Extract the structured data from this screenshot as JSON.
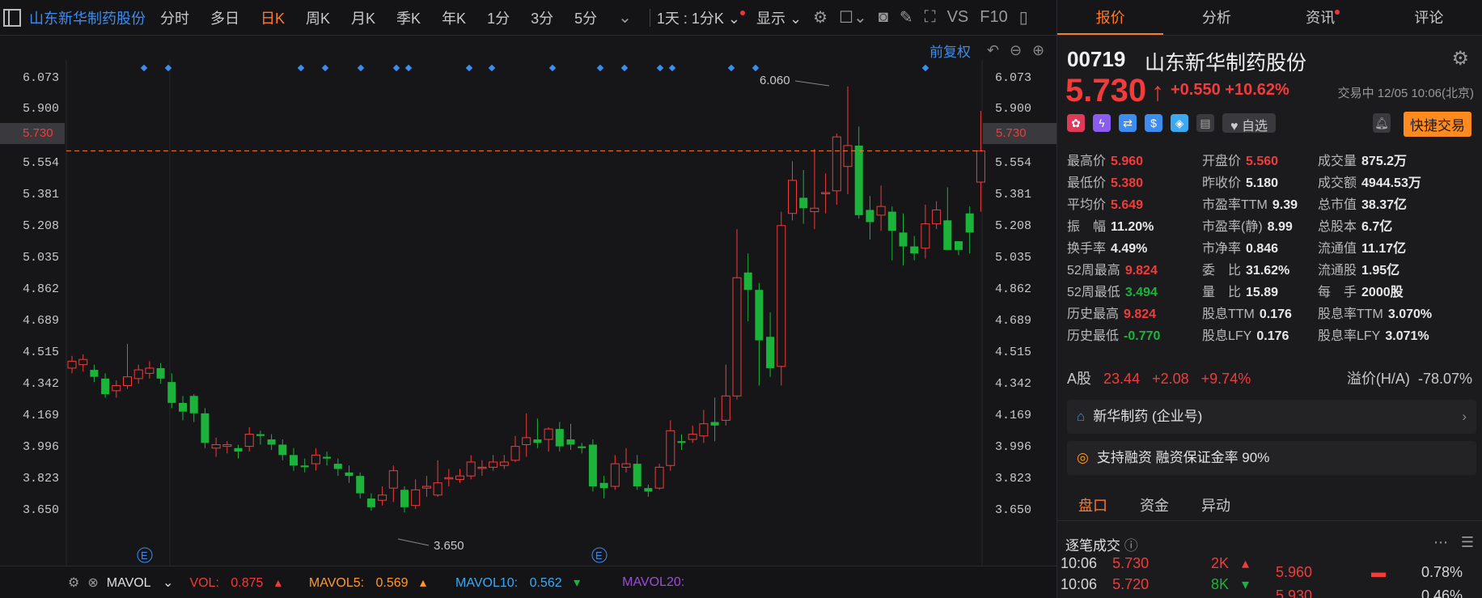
{
  "toolbar": {
    "stock_name": "山东新华制药股份",
    "tabs": [
      "分时",
      "多日",
      "日K",
      "周K",
      "月K",
      "季K",
      "年K",
      "1分",
      "3分",
      "5分"
    ],
    "active_tab": "日K",
    "period_select": "1天 : 1分K",
    "display_select": "显示",
    "vs_label": "VS",
    "f10_label": "F10"
  },
  "chart": {
    "restore_label": "前复权",
    "y_ticks": [
      "6.073",
      "5.900",
      "5.730",
      "5.554",
      "5.381",
      "5.208",
      "5.035",
      "4.862",
      "4.689",
      "4.515",
      "4.342",
      "4.169",
      "3.996",
      "3.823",
      "3.650"
    ],
    "current_price_label": "5.730",
    "high_mark": "6.060",
    "low_mark": "3.650",
    "event_marker": "E"
  },
  "chart_data": {
    "type": "candlestick",
    "ylim": [
      3.6,
      6.16
    ],
    "current_price": 5.73,
    "high_annotation": 6.06,
    "low_annotation": 3.65,
    "candles": [
      [
        4.48,
        4.52,
        4.55,
        4.45
      ],
      [
        4.5,
        4.53,
        4.56,
        4.46
      ],
      [
        4.47,
        4.43,
        4.5,
        4.4
      ],
      [
        4.42,
        4.33,
        4.45,
        4.31
      ],
      [
        4.35,
        4.38,
        4.41,
        4.31
      ],
      [
        4.38,
        4.43,
        4.62,
        4.36
      ],
      [
        4.42,
        4.47,
        4.5,
        4.39
      ],
      [
        4.45,
        4.48,
        4.52,
        4.42
      ],
      [
        4.48,
        4.42,
        4.51,
        4.39
      ],
      [
        4.4,
        4.28,
        4.45,
        4.25
      ],
      [
        4.28,
        4.23,
        4.32,
        4.18
      ],
      [
        4.32,
        4.22,
        4.33,
        4.17
      ],
      [
        4.22,
        4.05,
        4.25,
        4.02
      ],
      [
        4.02,
        4.04,
        4.08,
        3.97
      ],
      [
        4.03,
        4.04,
        4.06,
        3.99
      ],
      [
        4.02,
        4.0,
        4.04,
        3.96
      ],
      [
        4.03,
        4.1,
        4.14,
        4.0
      ],
      [
        4.1,
        4.09,
        4.12,
        4.04
      ],
      [
        4.07,
        4.04,
        4.1,
        4.01
      ],
      [
        4.04,
        3.98,
        4.07,
        3.95
      ],
      [
        3.98,
        3.92,
        4.02,
        3.89
      ],
      [
        3.92,
        3.91,
        3.96,
        3.88
      ],
      [
        3.93,
        3.98,
        4.02,
        3.89
      ],
      [
        3.97,
        3.96,
        4.0,
        3.92
      ],
      [
        3.93,
        3.9,
        3.96,
        3.86
      ],
      [
        3.88,
        3.86,
        3.92,
        3.82
      ],
      [
        3.86,
        3.76,
        3.88,
        3.73
      ],
      [
        3.73,
        3.68,
        3.76,
        3.66
      ],
      [
        3.72,
        3.75,
        3.8,
        3.69
      ],
      [
        3.79,
        3.89,
        3.92,
        3.71
      ],
      [
        3.78,
        3.68,
        3.8,
        3.65
      ],
      [
        3.69,
        3.78,
        3.84,
        3.67
      ],
      [
        3.79,
        3.8,
        3.86,
        3.74
      ],
      [
        3.75,
        3.82,
        3.95,
        3.74
      ],
      [
        3.85,
        3.85,
        3.9,
        3.8
      ],
      [
        3.84,
        3.86,
        3.9,
        3.82
      ],
      [
        3.86,
        3.94,
        3.98,
        3.84
      ],
      [
        3.91,
        3.91,
        3.95,
        3.86
      ],
      [
        3.91,
        3.94,
        3.98,
        3.89
      ],
      [
        3.92,
        3.94,
        3.98,
        3.9
      ],
      [
        3.95,
        4.03,
        4.09,
        3.94
      ],
      [
        4.04,
        4.08,
        4.22,
        3.97
      ],
      [
        4.07,
        4.05,
        4.19,
        4.02
      ],
      [
        4.07,
        4.13,
        4.14,
        4.0
      ],
      [
        4.13,
        4.03,
        4.17,
        4.0
      ],
      [
        4.07,
        4.04,
        4.16,
        4.01
      ],
      [
        4.03,
        4.02,
        4.05,
        3.99
      ],
      [
        4.04,
        3.8,
        4.07,
        3.77
      ],
      [
        3.82,
        3.79,
        3.86,
        3.73
      ],
      [
        3.8,
        3.93,
        3.98,
        3.78
      ],
      [
        3.91,
        3.93,
        4.02,
        3.88
      ],
      [
        3.93,
        3.8,
        3.98,
        3.78
      ],
      [
        3.79,
        3.77,
        3.81,
        3.74
      ],
      [
        3.79,
        3.91,
        3.93,
        3.78
      ],
      [
        3.92,
        4.12,
        4.18,
        3.89
      ],
      [
        4.06,
        4.05,
        4.1,
        4.01
      ],
      [
        4.07,
        4.1,
        4.15,
        4.05
      ],
      [
        4.09,
        4.16,
        4.24,
        4.05
      ],
      [
        4.17,
        4.15,
        4.31,
        4.06
      ],
      [
        4.18,
        4.32,
        4.5,
        4.15
      ],
      [
        4.32,
        5.0,
        5.28,
        4.3
      ],
      [
        5.03,
        4.93,
        5.14,
        4.75
      ],
      [
        4.93,
        4.64,
        4.97,
        4.38
      ],
      [
        4.66,
        4.48,
        4.8,
        4.43
      ],
      [
        4.49,
        5.3,
        5.38,
        4.38
      ],
      [
        5.37,
        5.56,
        5.67,
        5.33
      ],
      [
        5.46,
        5.4,
        5.62,
        5.31
      ],
      [
        5.38,
        5.4,
        5.74,
        5.28
      ],
      [
        5.49,
        5.49,
        5.6,
        5.37
      ],
      [
        5.5,
        5.81,
        5.83,
        5.42
      ],
      [
        5.64,
        5.76,
        6.1,
        5.48
      ],
      [
        5.76,
        5.36,
        5.87,
        5.34
      ],
      [
        5.39,
        5.32,
        5.47,
        5.22
      ],
      [
        5.36,
        5.41,
        5.53,
        5.27
      ],
      [
        5.38,
        5.27,
        5.41,
        5.1
      ],
      [
        5.26,
        5.18,
        5.37,
        5.07
      ],
      [
        5.18,
        5.14,
        5.24,
        5.1
      ],
      [
        5.17,
        5.31,
        5.42,
        5.11
      ],
      [
        5.31,
        5.39,
        5.44,
        5.28
      ],
      [
        5.33,
        5.16,
        5.52,
        5.16
      ],
      [
        5.21,
        5.16,
        5.21,
        5.13
      ],
      [
        5.37,
        5.26,
        5.41,
        5.14
      ],
      [
        5.55,
        5.73,
        5.96,
        5.38
      ]
    ]
  },
  "volume_bar": {
    "indicator": "MAVOL",
    "vol_label": "VOL:",
    "vol_value": "0.875",
    "mavol5_label": "MAVOL5:",
    "mavol5_value": "0.569",
    "mavol10_label": "MAVOL10:",
    "mavol10_value": "0.562",
    "mavol20_label": "MAVOL20:"
  },
  "right_panel": {
    "tabs": [
      "报价",
      "分析",
      "资讯",
      "评论"
    ],
    "active_tab": "报价",
    "code": "00719",
    "name": "山东新华制药股份",
    "price": "5.730",
    "change": "+0.550",
    "change_pct": "+10.62%",
    "status": "交易中 12/05 10:06(北京)",
    "watch_label": "自选",
    "quick_trade": "快捷交易",
    "stats": [
      [
        [
          "最高价",
          "5.960",
          "red"
        ],
        [
          "开盘价",
          "5.560",
          "red"
        ],
        [
          "成交量",
          "875.2万",
          ""
        ]
      ],
      [
        [
          "最低价",
          "5.380",
          "red"
        ],
        [
          "昨收价",
          "5.180",
          ""
        ],
        [
          "成交额",
          "4944.53万",
          ""
        ]
      ],
      [
        [
          "平均价",
          "5.649",
          "red"
        ],
        [
          "市盈率TTM",
          "9.39",
          ""
        ],
        [
          "总市值",
          "38.37亿",
          ""
        ]
      ],
      [
        [
          "振　幅",
          "11.20%",
          ""
        ],
        [
          "市盈率(静)",
          "8.99",
          ""
        ],
        [
          "总股本",
          "6.7亿",
          ""
        ]
      ],
      [
        [
          "换手率",
          "4.49%",
          ""
        ],
        [
          "市净率",
          "0.846",
          ""
        ],
        [
          "流通值",
          "11.17亿",
          ""
        ]
      ],
      [
        [
          "52周最高",
          "9.824",
          "red"
        ],
        [
          "委　比",
          "31.62%",
          ""
        ],
        [
          "流通股",
          "1.95亿",
          ""
        ]
      ],
      [
        [
          "52周最低",
          "3.494",
          "green"
        ],
        [
          "量　比",
          "15.89",
          ""
        ],
        [
          "每　手",
          "2000股",
          ""
        ]
      ],
      [
        [
          "历史最高",
          "9.824",
          "red"
        ],
        [
          "股息TTM",
          "0.176",
          ""
        ],
        [
          "股息率TTM",
          "3.070%",
          ""
        ]
      ],
      [
        [
          "历史最低",
          "-0.770",
          "green"
        ],
        [
          "股息LFY",
          "0.176",
          ""
        ],
        [
          "股息率LFY",
          "3.071%",
          ""
        ]
      ]
    ],
    "a_share_label": "A股",
    "a_share_price": "23.44",
    "a_share_change": "+2.08",
    "a_share_pct": "+9.74%",
    "premium_label": "溢价(H/A)",
    "premium_value": "-78.07%",
    "company_card": "新华制药 (企业号)",
    "margin_card": "支持融资 融资保证金率 90%",
    "bottom_tabs": [
      "盘口",
      "资金",
      "异动"
    ],
    "ticks_title": "逐笔成交",
    "ticks": [
      {
        "time": "10:06",
        "price": "5.730",
        "vol": "2K"
      },
      {
        "time": "10:06",
        "price": "5.720",
        "vol": "8K"
      }
    ],
    "book": [
      {
        "price": "5.960",
        "pct": "0.78%"
      },
      {
        "price": "5.930",
        "pct": "0.46%"
      }
    ]
  }
}
